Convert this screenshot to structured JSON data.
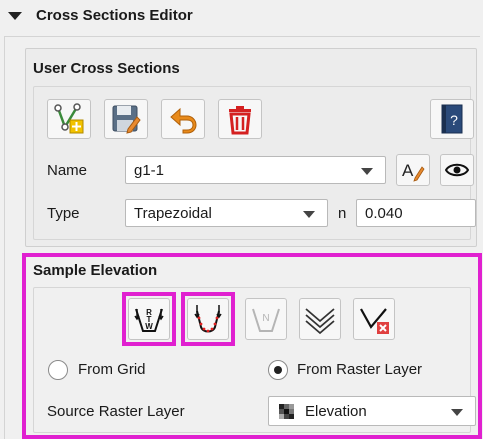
{
  "panel": {
    "title": "Cross Sections Editor"
  },
  "user_cross_sections": {
    "title": "User Cross Sections",
    "toolbar": {
      "buttons": [
        "add-cross-section-icon",
        "save-icon",
        "revert-icon",
        "delete-icon",
        "help-icon"
      ]
    },
    "name_label": "Name",
    "name_value": "g1-1",
    "type_label": "Type",
    "type_value": "Trapezoidal",
    "n_label": "n",
    "n_value": "0.040"
  },
  "sample_elevation": {
    "title": "Sample Elevation",
    "from_grid_label": "From Grid",
    "from_raster_label": "From Raster Layer",
    "selected_source": "From Raster Layer",
    "source_raster_label": "Source Raster Layer",
    "source_raster_value": "Elevation"
  },
  "colors": {
    "highlight": "#e020d0",
    "delete_red": "#d42020",
    "help_blue": "#2a4a7a"
  }
}
